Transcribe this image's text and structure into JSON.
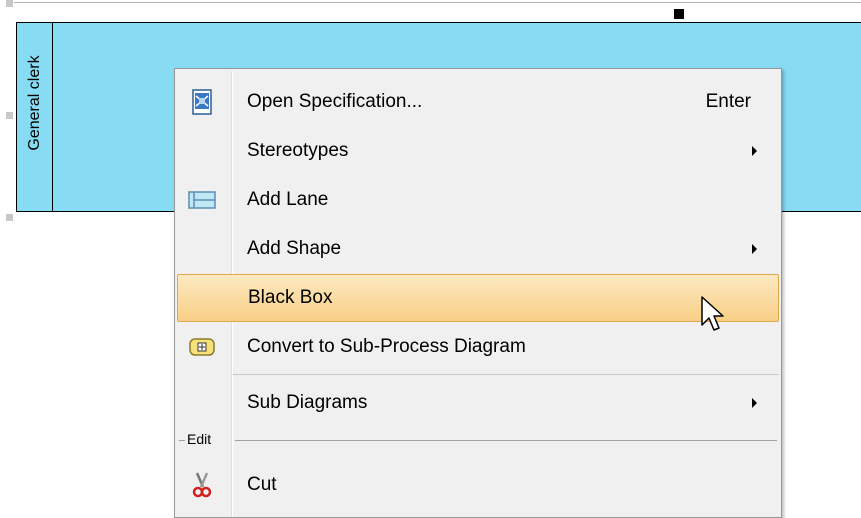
{
  "pool": {
    "lane_label": "General clerk",
    "fill_color": "#87dbf2"
  },
  "context_menu": {
    "items": [
      {
        "label": "Open Specification...",
        "shortcut": "Enter",
        "icon": "specification-icon"
      },
      {
        "label": "Stereotypes",
        "submenu": true
      },
      {
        "label": "Add Lane",
        "icon": "add-lane-icon"
      },
      {
        "label": "Add Shape",
        "submenu": true
      },
      {
        "label": "Black Box",
        "highlighted": true
      },
      {
        "label": "Convert to Sub-Process Diagram",
        "icon": "sub-process-icon"
      },
      {
        "label": "Sub Diagrams",
        "submenu": true
      },
      {
        "label": "Cut",
        "icon": "scissors-icon"
      }
    ],
    "group_label": "Edit",
    "highlight_color": "#f8cf86"
  }
}
